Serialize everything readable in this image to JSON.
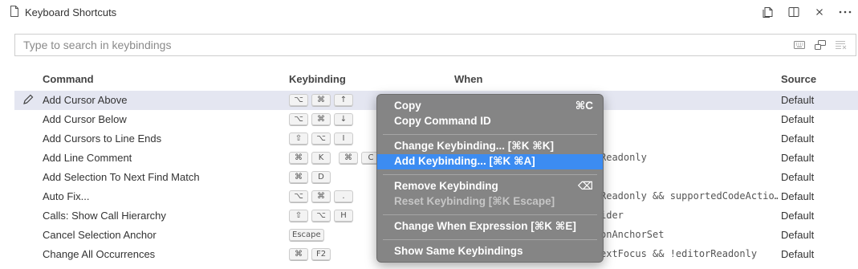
{
  "tab": {
    "title": "Keyboard Shortcuts",
    "file_icon": "file-icon",
    "actions": [
      "open-json-icon",
      "split-editor-icon",
      "close-icon",
      "more-actions-icon"
    ]
  },
  "search": {
    "placeholder": "Type to search in keybindings",
    "value": "",
    "icons": [
      "keyboard-icon",
      "sort-by-precedence-icon",
      "clear-filter-icon"
    ]
  },
  "table": {
    "headers": {
      "command": "Command",
      "keybinding": "Keybinding",
      "when": "When",
      "source": "Source"
    },
    "rows": [
      {
        "command": "Add Cursor Above",
        "keys": [
          "⌥",
          "⌘",
          "↑"
        ],
        "when": "",
        "source": "Default",
        "selected": true
      },
      {
        "command": "Add Cursor Below",
        "keys": [
          "⌥",
          "⌘",
          "↓"
        ],
        "when": "",
        "source": "Default"
      },
      {
        "command": "Add Cursors to Line Ends",
        "keys": [
          "⇧",
          "⌥",
          "I"
        ],
        "when": "",
        "source": "Default"
      },
      {
        "command": "Add Line Comment",
        "keys": [
          "⌘",
          "K",
          "|",
          "⌘",
          "C"
        ],
        "when": "Readonly",
        "source": "Default"
      },
      {
        "command": "Add Selection To Next Find Match",
        "keys": [
          "⌘",
          "D"
        ],
        "when": "",
        "source": "Default"
      },
      {
        "command": "Auto Fix...",
        "keys": [
          "⌥",
          "⌘",
          "."
        ],
        "when": "Readonly && supportedCodeActio…",
        "source": "Default"
      },
      {
        "command": "Calls: Show Call Hierarchy",
        "keys": [
          "⇧",
          "⌥",
          "H"
        ],
        "when": "ider",
        "source": "Default"
      },
      {
        "command": "Cancel Selection Anchor",
        "keys": [
          "Escape"
        ],
        "when": "onAnchorSet",
        "source": "Default"
      },
      {
        "command": "Change All Occurrences",
        "keys": [
          "⌘",
          "F2"
        ],
        "when": "extFocus && !editorReadonly",
        "source": "Default"
      }
    ]
  },
  "context_menu": {
    "items": [
      {
        "label": "Copy",
        "shortcut": "⌘C"
      },
      {
        "label": "Copy Command ID",
        "shortcut": ""
      },
      {
        "separator": true
      },
      {
        "label": "Change Keybinding... [⌘K ⌘K]",
        "shortcut": ""
      },
      {
        "label": "Add Keybinding... [⌘K ⌘A]",
        "shortcut": "",
        "active": true
      },
      {
        "separator": true
      },
      {
        "label": "Remove Keybinding",
        "shortcut": "⌫"
      },
      {
        "label": "Reset Keybinding [⌘K Escape]",
        "shortcut": "",
        "disabled": true
      },
      {
        "separator": true
      },
      {
        "label": "Change When Expression [⌘K ⌘E]",
        "shortcut": ""
      },
      {
        "separator": true
      },
      {
        "label": "Show Same Keybindings",
        "shortcut": ""
      }
    ]
  },
  "colors": {
    "selected_row": "#e4e6f1",
    "menu_background": "#808080",
    "menu_highlight": "#3c8cf2"
  }
}
